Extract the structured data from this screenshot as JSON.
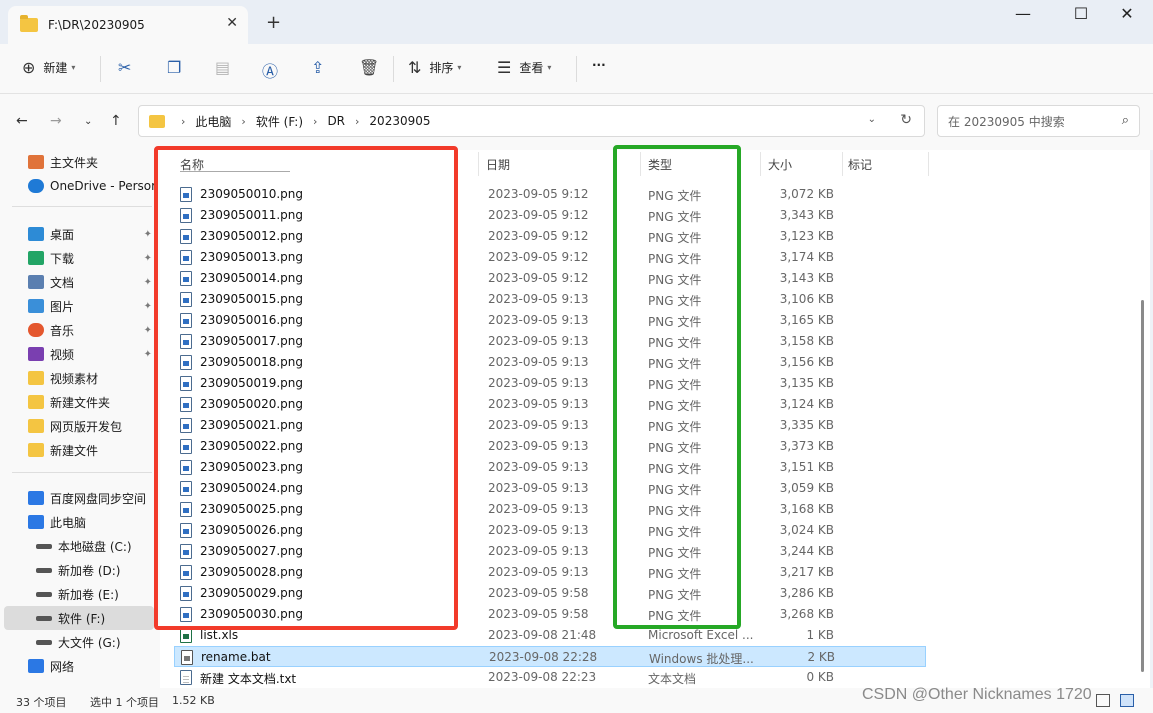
{
  "window": {
    "tab_title": "F:\\DR\\20230905",
    "new_tab": "+",
    "minimize": "—",
    "maximize": "☐",
    "close": "✕"
  },
  "toolbar": {
    "new_label": "新建",
    "sort_label": "排序",
    "view_label": "查看",
    "more_label": "···"
  },
  "address": {
    "crumbs": [
      "此电脑",
      "软件 (F:)",
      "DR",
      "20230905"
    ],
    "search_placeholder": "在 20230905 中搜索"
  },
  "sidebar": {
    "items": [
      {
        "label": "主文件夹",
        "icon": "home-icon",
        "color": "#e0733a"
      },
      {
        "label": "OneDrive - Persor",
        "icon": "cloud-icon",
        "color": "#1f7ad6"
      },
      {
        "label": "桌面",
        "icon": "desktop-icon",
        "color": "#2d8bd6",
        "pinned": true
      },
      {
        "label": "下载",
        "icon": "download-icon",
        "color": "#23a566",
        "pinned": true
      },
      {
        "label": "文档",
        "icon": "document-icon",
        "color": "#5b7fb0",
        "pinned": true
      },
      {
        "label": "图片",
        "icon": "picture-icon",
        "color": "#3a8fd9",
        "pinned": true
      },
      {
        "label": "音乐",
        "icon": "music-icon",
        "color": "#e4572e",
        "pinned": true
      },
      {
        "label": "视频",
        "icon": "video-icon",
        "color": "#7a3fb0",
        "pinned": true
      },
      {
        "label": "视频素材",
        "icon": "folder-icon",
        "color": "#f4c542"
      },
      {
        "label": "新建文件夹",
        "icon": "folder-icon",
        "color": "#f4c542"
      },
      {
        "label": "网页版开发包",
        "icon": "folder-icon",
        "color": "#f4c542"
      },
      {
        "label": "新建文件",
        "icon": "folder-icon",
        "color": "#f4c542"
      },
      {
        "label": "百度网盘同步空间",
        "icon": "baidu-netdisk-icon",
        "color": "#2b78e4"
      },
      {
        "label": "此电脑",
        "icon": "computer-icon",
        "color": "#2b78e4"
      },
      {
        "label": "本地磁盘 (C:)",
        "icon": "drive-icon",
        "color": "#555555"
      },
      {
        "label": "新加卷 (D:)",
        "icon": "drive-icon",
        "color": "#555555"
      },
      {
        "label": "新加卷 (E:)",
        "icon": "drive-icon",
        "color": "#555555"
      },
      {
        "label": "软件 (F:)",
        "icon": "drive-icon",
        "color": "#555555",
        "selected": true
      },
      {
        "label": "大文件 (G:)",
        "icon": "drive-icon",
        "color": "#555555"
      },
      {
        "label": "网络",
        "icon": "network-icon",
        "color": "#2b78e4"
      }
    ]
  },
  "columns": {
    "name": "名称",
    "date": "日期",
    "type": "类型",
    "size": "大小",
    "tags": "标记"
  },
  "files": [
    {
      "name": "2309050010.png",
      "date": "2023-09-05 9:12",
      "type": "PNG 文件",
      "size": "3,072 KB",
      "kind": "png"
    },
    {
      "name": "2309050011.png",
      "date": "2023-09-05 9:12",
      "type": "PNG 文件",
      "size": "3,343 KB",
      "kind": "png"
    },
    {
      "name": "2309050012.png",
      "date": "2023-09-05 9:12",
      "type": "PNG 文件",
      "size": "3,123 KB",
      "kind": "png"
    },
    {
      "name": "2309050013.png",
      "date": "2023-09-05 9:12",
      "type": "PNG 文件",
      "size": "3,174 KB",
      "kind": "png"
    },
    {
      "name": "2309050014.png",
      "date": "2023-09-05 9:12",
      "type": "PNG 文件",
      "size": "3,143 KB",
      "kind": "png"
    },
    {
      "name": "2309050015.png",
      "date": "2023-09-05 9:13",
      "type": "PNG 文件",
      "size": "3,106 KB",
      "kind": "png"
    },
    {
      "name": "2309050016.png",
      "date": "2023-09-05 9:13",
      "type": "PNG 文件",
      "size": "3,165 KB",
      "kind": "png"
    },
    {
      "name": "2309050017.png",
      "date": "2023-09-05 9:13",
      "type": "PNG 文件",
      "size": "3,158 KB",
      "kind": "png"
    },
    {
      "name": "2309050018.png",
      "date": "2023-09-05 9:13",
      "type": "PNG 文件",
      "size": "3,156 KB",
      "kind": "png"
    },
    {
      "name": "2309050019.png",
      "date": "2023-09-05 9:13",
      "type": "PNG 文件",
      "size": "3,135 KB",
      "kind": "png"
    },
    {
      "name": "2309050020.png",
      "date": "2023-09-05 9:13",
      "type": "PNG 文件",
      "size": "3,124 KB",
      "kind": "png"
    },
    {
      "name": "2309050021.png",
      "date": "2023-09-05 9:13",
      "type": "PNG 文件",
      "size": "3,335 KB",
      "kind": "png"
    },
    {
      "name": "2309050022.png",
      "date": "2023-09-05 9:13",
      "type": "PNG 文件",
      "size": "3,373 KB",
      "kind": "png"
    },
    {
      "name": "2309050023.png",
      "date": "2023-09-05 9:13",
      "type": "PNG 文件",
      "size": "3,151 KB",
      "kind": "png"
    },
    {
      "name": "2309050024.png",
      "date": "2023-09-05 9:13",
      "type": "PNG 文件",
      "size": "3,059 KB",
      "kind": "png"
    },
    {
      "name": "2309050025.png",
      "date": "2023-09-05 9:13",
      "type": "PNG 文件",
      "size": "3,168 KB",
      "kind": "png"
    },
    {
      "name": "2309050026.png",
      "date": "2023-09-05 9:13",
      "type": "PNG 文件",
      "size": "3,024 KB",
      "kind": "png"
    },
    {
      "name": "2309050027.png",
      "date": "2023-09-05 9:13",
      "type": "PNG 文件",
      "size": "3,244 KB",
      "kind": "png"
    },
    {
      "name": "2309050028.png",
      "date": "2023-09-05 9:13",
      "type": "PNG 文件",
      "size": "3,217 KB",
      "kind": "png"
    },
    {
      "name": "2309050029.png",
      "date": "2023-09-05 9:58",
      "type": "PNG 文件",
      "size": "3,286 KB",
      "kind": "png"
    },
    {
      "name": "2309050030.png",
      "date": "2023-09-05 9:58",
      "type": "PNG 文件",
      "size": "3,268 KB",
      "kind": "png"
    },
    {
      "name": "list.xls",
      "date": "2023-09-08 21:48",
      "type": "Microsoft Excel ...",
      "size": "1 KB",
      "kind": "xls"
    },
    {
      "name": "rename.bat",
      "date": "2023-09-08 22:28",
      "type": "Windows 批处理...",
      "size": "2 KB",
      "kind": "bat",
      "selected": true
    },
    {
      "name": "新建 文本文档.txt",
      "date": "2023-09-08 22:23",
      "type": "文本文档",
      "size": "0 KB",
      "kind": "txt"
    }
  ],
  "status": {
    "count": "33 个项目",
    "selected": "选中 1 个项目",
    "size": "1.52 KB"
  },
  "watermark": "CSDN @Other Nicknames 1720",
  "highlight_colors": {
    "red": "#f23a2a",
    "green": "#26a826"
  }
}
